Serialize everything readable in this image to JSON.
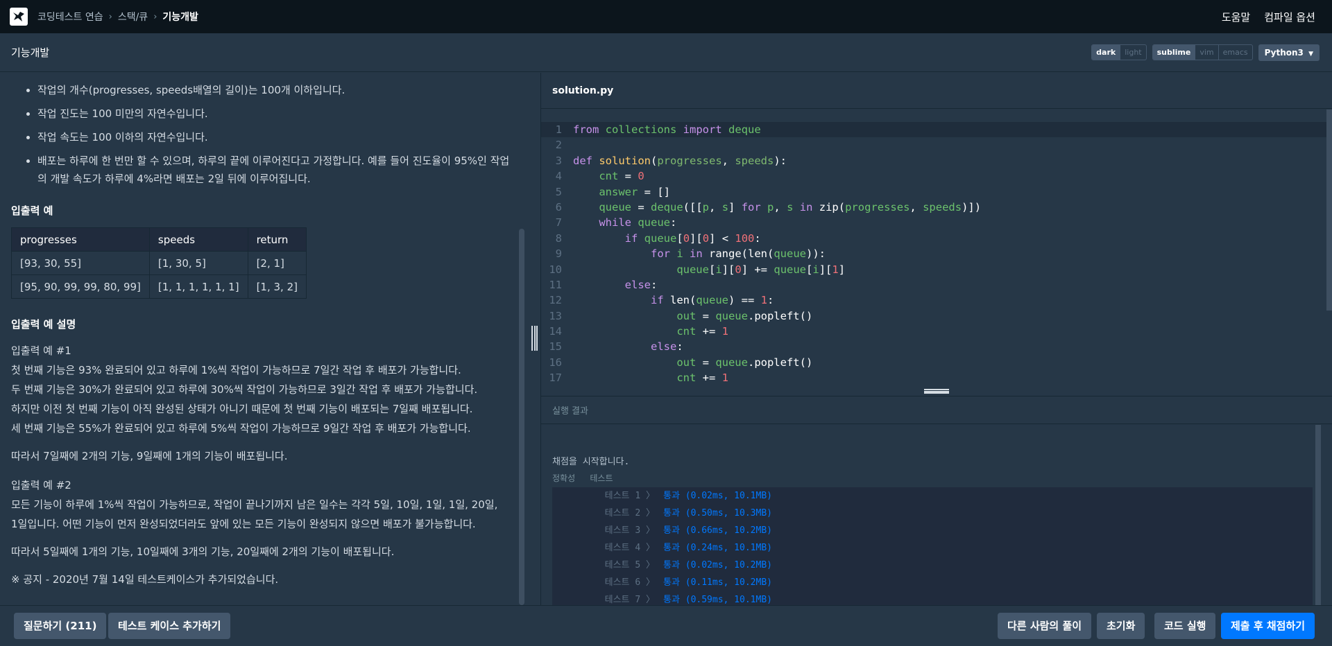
{
  "nav": {
    "breadcrumb": [
      "코딩테스트 연습",
      "스택/큐",
      "기능개발"
    ],
    "help": "도움말",
    "compile_options": "컴파일 옵션"
  },
  "titlebar": {
    "title": "기능개발",
    "theme": [
      "dark",
      "light"
    ],
    "keymap": [
      "sublime",
      "vim",
      "emacs"
    ],
    "language": "Python3"
  },
  "problem": {
    "constraints": [
      "작업의 개수(progresses, speeds배열의 길이)는 100개 이하입니다.",
      "작업 진도는 100 미만의 자연수입니다.",
      "작업 속도는 100 이하의 자연수입니다.",
      "배포는 하루에 한 번만 할 수 있으며, 하루의 끝에 이루어진다고 가정합니다. 예를 들어 진도율이 95%인 작업의 개발 속도가 하루에 4%라면 배포는 2일 뒤에 이루어집니다."
    ],
    "examples_heading": "입출력 예",
    "table": {
      "headers": [
        "progresses",
        "speeds",
        "return"
      ],
      "rows": [
        [
          "[93, 30, 55]",
          "[1, 30, 5]",
          "[2, 1]"
        ],
        [
          "[95, 90, 99, 99, 80, 99]",
          "[1, 1, 1, 1, 1, 1]",
          "[1, 3, 2]"
        ]
      ]
    },
    "explain_heading": "입출력 예 설명",
    "ex1_title": "입출력 예 #1",
    "ex1_lines": [
      "첫 번째 기능은 93% 완료되어 있고 하루에 1%씩 작업이 가능하므로 7일간 작업 후 배포가 가능합니다.",
      "두 번째 기능은 30%가 완료되어 있고 하루에 30%씩 작업이 가능하므로 3일간 작업 후 배포가 가능합니다.",
      "하지만 이전 첫 번째 기능이 아직 완성된 상태가 아니기 때문에 첫 번째 기능이 배포되는 7일째 배포됩니다.",
      "세 번째 기능은 55%가 완료되어 있고 하루에 5%씩 작업이 가능하므로 9일간 작업 후 배포가 가능합니다."
    ],
    "ex1_summary": "따라서 7일째에 2개의 기능, 9일째에 1개의 기능이 배포됩니다.",
    "ex2_title": "입출력 예 #2",
    "ex2_lines": [
      "모든 기능이 하루에 1%씩 작업이 가능하므로, 작업이 끝나기까지 남은 일수는 각각 5일, 10일, 1일, 1일, 20일,",
      "1일입니다. 어떤 기능이 먼저 완성되었더라도 앞에 있는 모든 기능이 완성되지 않으면 배포가 불가능합니다."
    ],
    "ex2_summary": "따라서 5일째에 1개의 기능, 10일째에 3개의 기능, 20일째에 2개의 기능이 배포됩니다.",
    "notice": "※ 공지 - 2020년 7월 14일 테스트케이스가 추가되었습니다."
  },
  "editor": {
    "filename": "solution.py",
    "lines": [
      "from collections import deque",
      "",
      "def solution(progresses, speeds):",
      "    cnt = 0",
      "    answer = []",
      "    queue = deque([[p, s] for p, s in zip(progresses, speeds)])",
      "    while queue:",
      "        if queue[0][0] < 100:",
      "            for i in range(len(queue)):",
      "                queue[i][0] += queue[i][1]",
      "        else:",
      "            if len(queue) == 1:",
      "                out = queue.popleft()",
      "                cnt += 1",
      "            else:",
      "                out = queue.popleft()",
      "                cnt += 1"
    ]
  },
  "results": {
    "heading": "실행 결과",
    "start": "채점을 시작합니다.",
    "columns": [
      "정확성",
      "테스트"
    ],
    "tests": [
      {
        "name": "테스트 1 〉",
        "result": "통과 (0.02ms, 10.1MB)"
      },
      {
        "name": "테스트 2 〉",
        "result": "통과 (0.50ms, 10.3MB)"
      },
      {
        "name": "테스트 3 〉",
        "result": "통과 (0.66ms, 10.2MB)"
      },
      {
        "name": "테스트 4 〉",
        "result": "통과 (0.24ms, 10.1MB)"
      },
      {
        "name": "테스트 5 〉",
        "result": "통과 (0.02ms, 10.2MB)"
      },
      {
        "name": "테스트 6 〉",
        "result": "통과 (0.11ms, 10.2MB)"
      },
      {
        "name": "테스트 7 〉",
        "result": "통과 (0.59ms, 10.1MB)"
      }
    ]
  },
  "bottom": {
    "question": "질문하기 (211)",
    "add_testcase": "테스트 케이스 추가하기",
    "others": "다른 사람의 풀이",
    "reset": "초기화",
    "run": "코드 실행",
    "submit": "제출 후 채점하기"
  },
  "colors": {
    "accent": "#0078ff",
    "bg": "#263747",
    "nav": "#0c151c"
  }
}
